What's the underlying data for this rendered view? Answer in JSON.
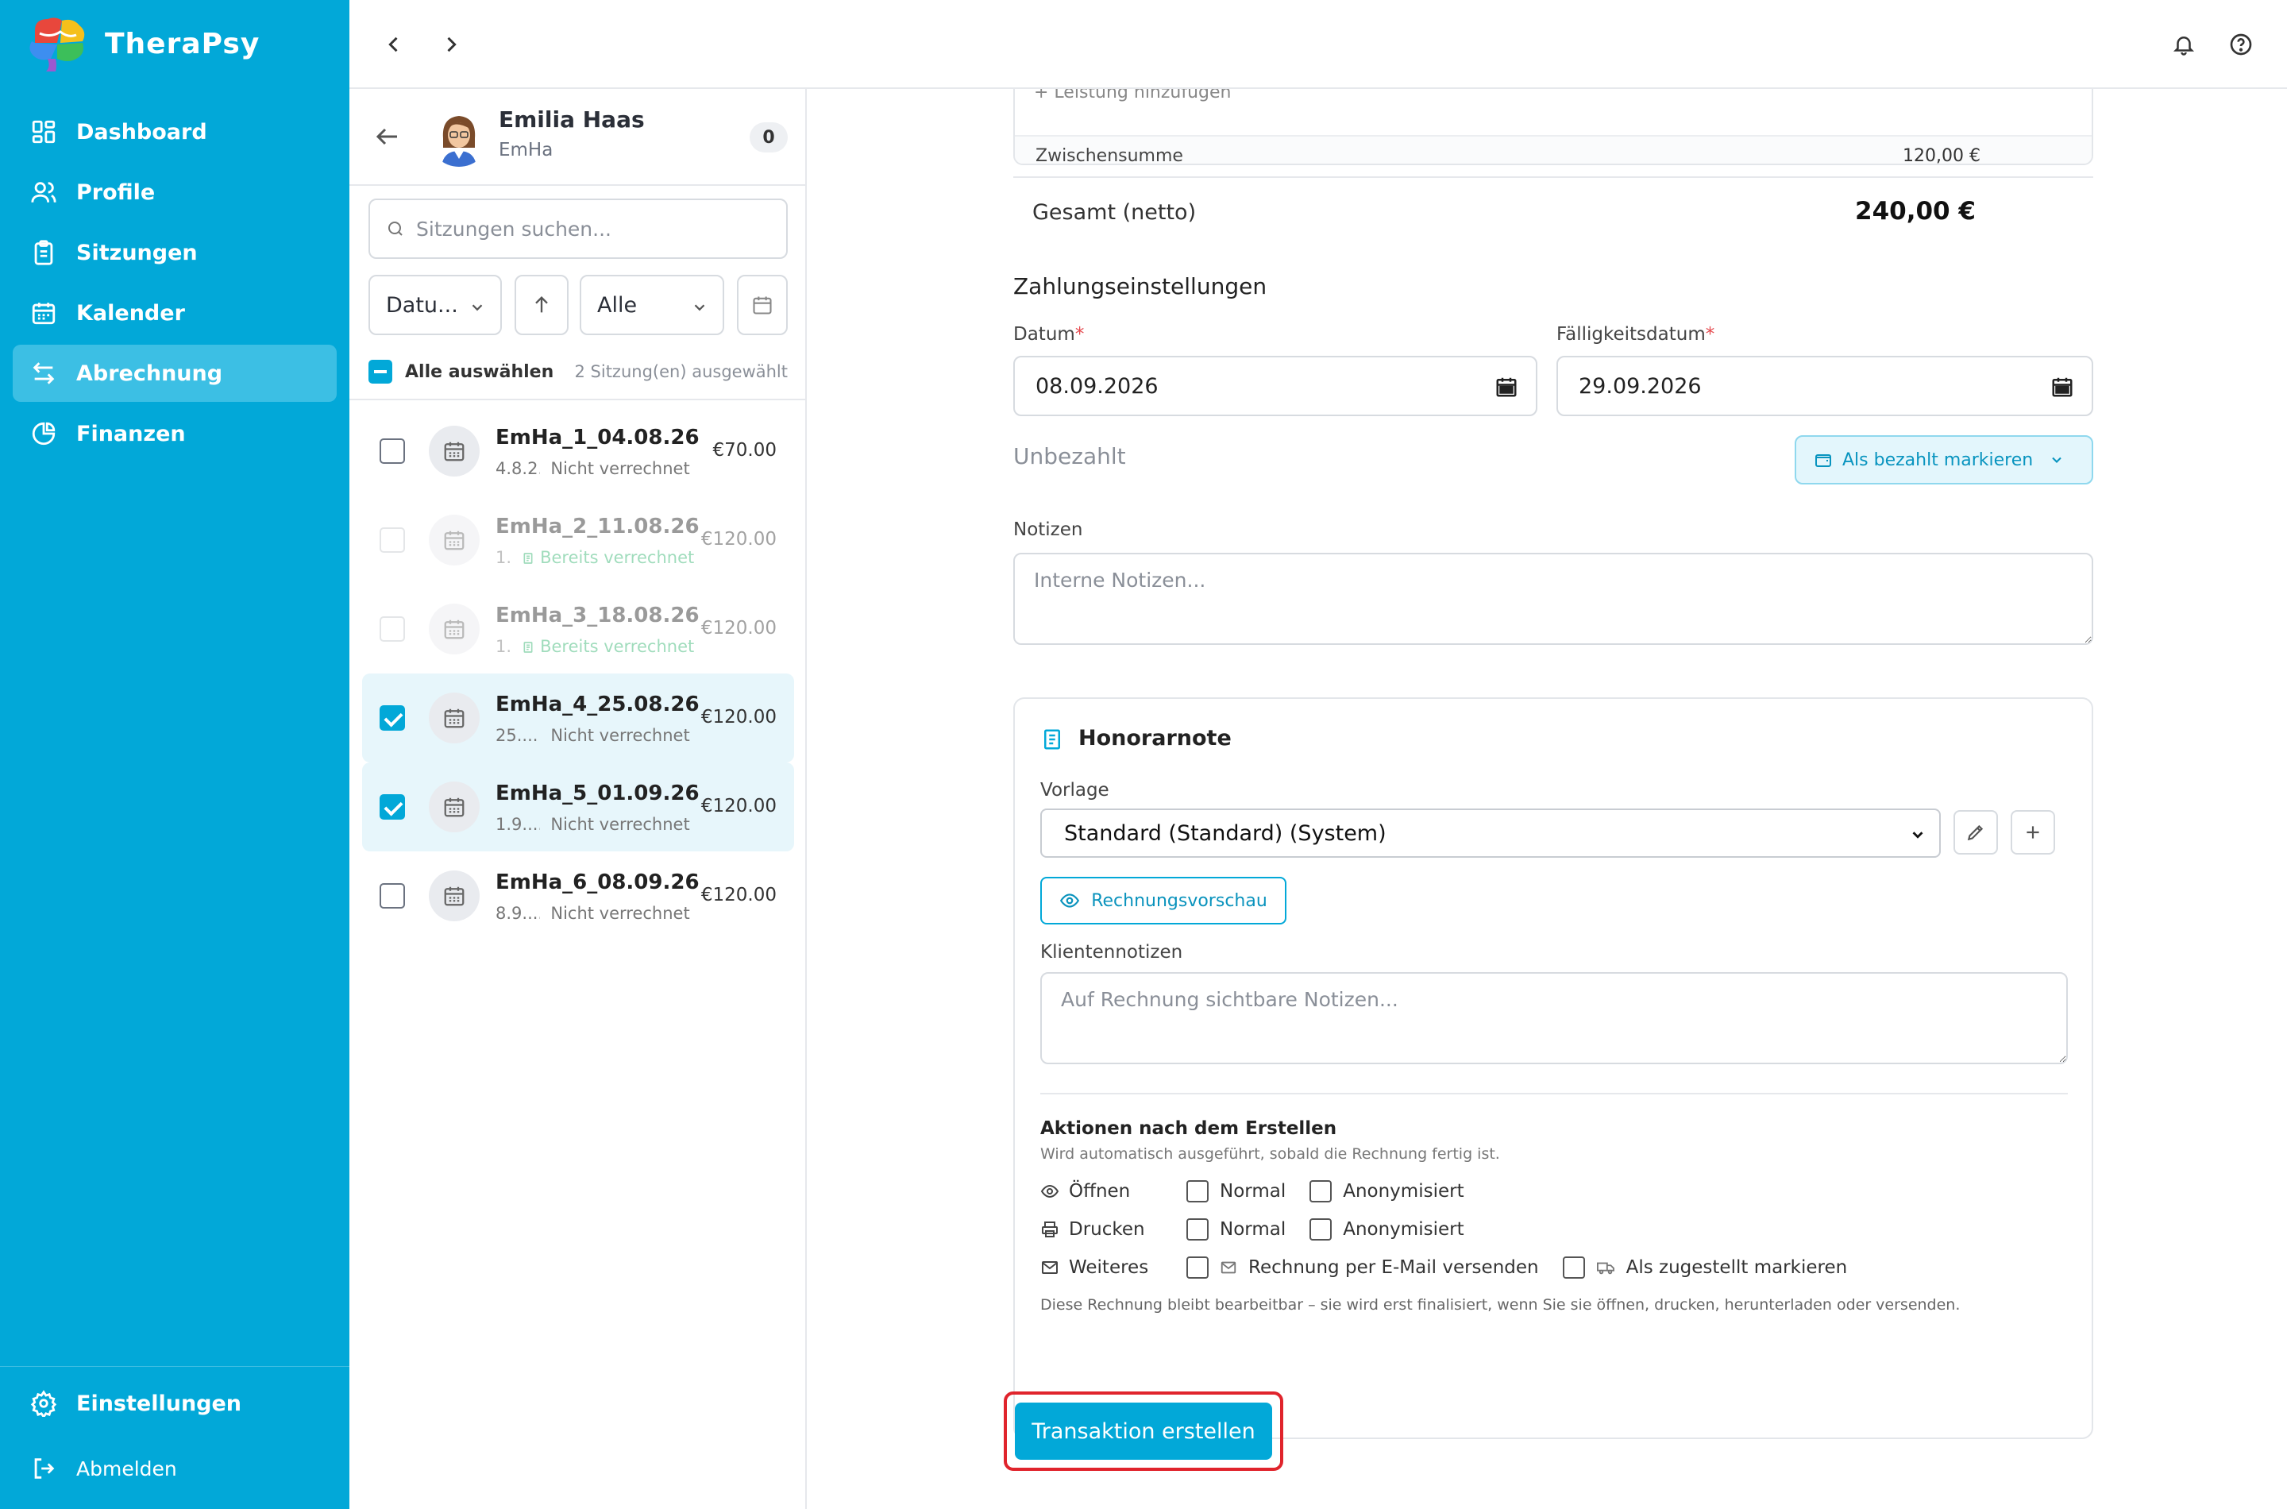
{
  "app": {
    "name": "TheraPsy"
  },
  "sidebar": {
    "items": [
      {
        "label": "Dashboard",
        "icon": "dashboard-icon"
      },
      {
        "label": "Profile",
        "icon": "users-icon"
      },
      {
        "label": "Sitzungen",
        "icon": "clipboard-icon"
      },
      {
        "label": "Kalender",
        "icon": "calendar-icon"
      },
      {
        "label": "Abrechnung",
        "icon": "transfer-icon",
        "active": true
      },
      {
        "label": "Finanzen",
        "icon": "pie-chart-icon"
      }
    ],
    "settings_label": "Einstellungen",
    "logout_label": "Abmelden"
  },
  "client": {
    "name": "Emilia Haas",
    "short": "EmHa",
    "count": "0"
  },
  "search": {
    "placeholder": "Sitzungen suchen..."
  },
  "filters": {
    "sort_field": "Datu...",
    "status": "Alle"
  },
  "selection": {
    "select_all_label": "Alle auswählen",
    "selected_count": "2 Sitzung(en) ausgewählt"
  },
  "sessions": [
    {
      "title": "EmHa_1_04.08.26",
      "date": "4.8.2...",
      "status": "Nicht verrechnet",
      "price": "€70.00",
      "state": "unchecked"
    },
    {
      "title": "EmHa_2_11.08.26",
      "date": "1.",
      "status": "Bereits verrechnet",
      "price": "€120.00",
      "state": "disabled"
    },
    {
      "title": "EmHa_3_18.08.26",
      "date": "1.",
      "status": "Bereits verrechnet",
      "price": "€120.00",
      "state": "disabled"
    },
    {
      "title": "EmHa_4_25.08.26",
      "date": "25....",
      "status": "Nicht verrechnet",
      "price": "€120.00",
      "state": "checked"
    },
    {
      "title": "EmHa_5_01.09.26",
      "date": "1.9....",
      "status": "Nicht verrechnet",
      "price": "€120.00",
      "state": "checked"
    },
    {
      "title": "EmHa_6_08.09.26",
      "date": "8.9....",
      "status": "Nicht verrechnet",
      "price": "€120.00",
      "state": "unchecked"
    }
  ],
  "summary": {
    "add_service_cut": "+ Leistung hinzufügen",
    "subtotal_label": "Zwischensumme",
    "subtotal_value": "120,00 €",
    "total_label": "Gesamt (netto)",
    "total_value": "240,00 €"
  },
  "payment": {
    "title": "Zahlungseinstellungen",
    "date_label": "Datum",
    "date_value": "08.09.2026",
    "due_label": "Fälligkeitsdatum",
    "due_value": "29.09.2026",
    "status": "Unbezahlt",
    "mark_paid_label": "Als bezahlt markieren",
    "notes_label": "Notizen",
    "notes_placeholder": "Interne Notizen..."
  },
  "invoice": {
    "title": "Honorarnote",
    "template_label": "Vorlage",
    "template_value": "Standard (Standard) (System)",
    "preview_label": "Rechnungsvorschau",
    "client_notes_label": "Klientennotizen",
    "client_notes_placeholder": "Auf Rechnung sichtbare Notizen...",
    "actions_title": "Aktionen nach dem Erstellen",
    "actions_sub": "Wird automatisch ausgeführt, sobald die Rechnung fertig ist.",
    "open_label": "Öffnen",
    "print_label": "Drucken",
    "more_label": "Weiteres",
    "normal_label": "Normal",
    "anon_label": "Anonymisiert",
    "email_label": "Rechnung per E-Mail versenden",
    "delivered_label": "Als zugestellt markieren",
    "footer_note": "Diese Rechnung bleibt bearbeitbar – sie wird erst finalisiert, wenn Sie sie öffnen, drucken, herunterladen oder versenden."
  },
  "create_button": "Transaktion erstellen",
  "colors": {
    "primary": "#02a8d8",
    "success": "#2fb36d",
    "highlight": "#e0242c"
  }
}
